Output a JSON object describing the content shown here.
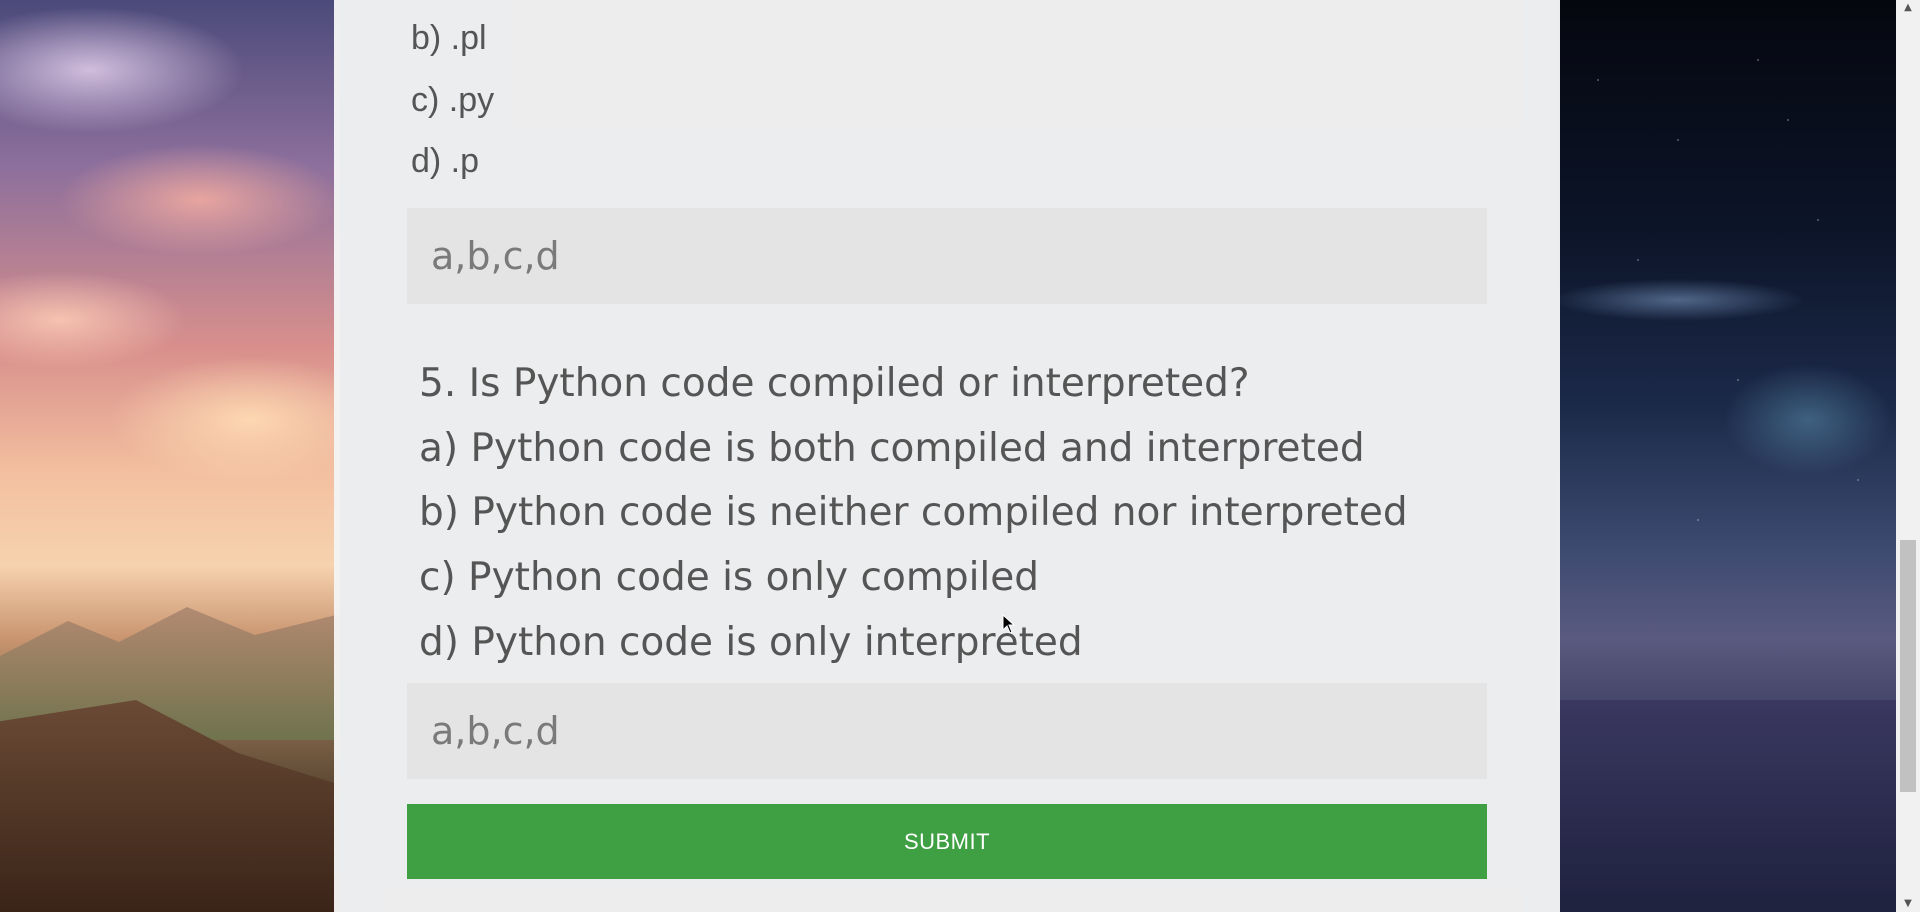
{
  "quiz": {
    "prev_question_options": [
      "b) .pl",
      "c) .py",
      "d) .p"
    ],
    "prev_answer_placeholder": "a,b,c,d",
    "question5": {
      "title": "5. Is Python code compiled or interpreted?",
      "options": [
        "a) Python code is both compiled and interpreted",
        "b) Python code is neither compiled nor interpreted",
        "c) Python code is only compiled",
        "d) Python code is only interpreted"
      ],
      "answer_placeholder": "a,b,c,d"
    },
    "submit_label": "SUBMIT"
  },
  "colors": {
    "submit_bg": "#3f9f43",
    "panel_bg": "#f4f4f4",
    "input_bg": "#e4e4e4",
    "text": "#555555"
  }
}
